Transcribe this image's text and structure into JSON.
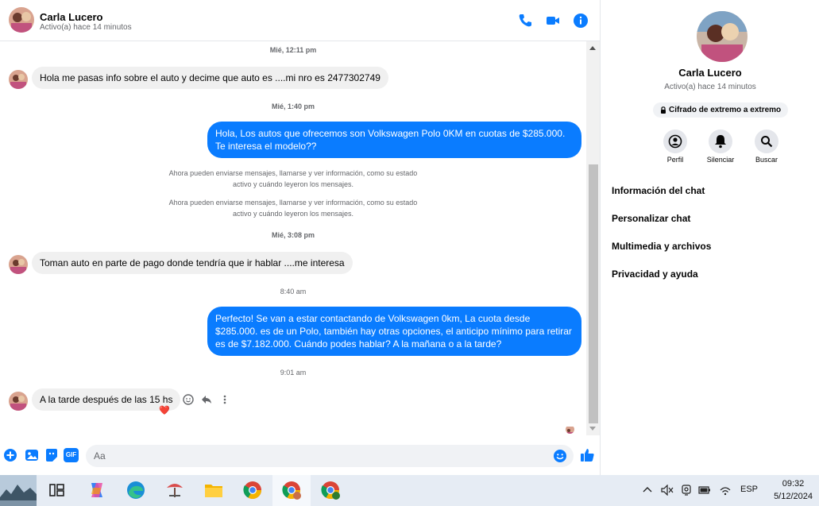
{
  "header": {
    "name": "Carla Lucero",
    "status": "Activo(a) hace 14 minutos",
    "icons": [
      "phone-icon",
      "video-icon",
      "info-icon"
    ],
    "accent": "#0a7cff"
  },
  "messages": {
    "t1": "Mié, 12:11 pm",
    "m1": "Hola me pasas info sobre el auto y decime que auto es ....mi nro es 2477302749",
    "t2": "Mié, 1:40 pm",
    "m2": "Hola, Los autos que ofrecemos son Volkswagen Polo 0KM en cuotas de $285.000. Te interesa el modelo??",
    "sys1a": "Ahora pueden enviarse mensajes, llamarse y ver información, como su estado",
    "sys1b": "activo y cuándo leyeron los mensajes.",
    "sys2a": "Ahora pueden enviarse mensajes, llamarse y ver información, como su estado",
    "sys2b": "activo y cuándo leyeron los mensajes.",
    "t3": "Mié, 3:08 pm",
    "m3": "Toman auto en parte de pago donde tendría que ir hablar ....me interesa",
    "t4": "8:40 am",
    "m4": "Perfecto!  Se van a estar contactando de Volkswagen 0km, La cuota desde $285.000. es de un Polo, también hay otras opciones, el anticipo mínimo para retirar es de $7.182.000. Cuándo podes hablar? A la mañana o a la tarde?",
    "t5": "9:01 am",
    "m5": "A la tarde después de las 15 hs",
    "m5_reaction": "❤️"
  },
  "composer": {
    "placeholder": "Aa",
    "icons": [
      "plus-icon",
      "image-icon",
      "sticker-icon",
      "gif-icon",
      "emoji-icon",
      "like-icon"
    ],
    "gif_label": "GIF"
  },
  "panel": {
    "name": "Carla Lucero",
    "status": "Activo(a) hace 14 minutos",
    "encryption": "Cifrado de extremo a extremo",
    "actions": [
      "Perfil",
      "Silenciar",
      "Buscar"
    ],
    "items": [
      "Información del chat",
      "Personalizar chat",
      "Multimedia y archivos",
      "Privacidad y ayuda"
    ]
  },
  "taskbar": {
    "lang": "ESP",
    "time": "09:32",
    "date": "5/12/2024"
  }
}
